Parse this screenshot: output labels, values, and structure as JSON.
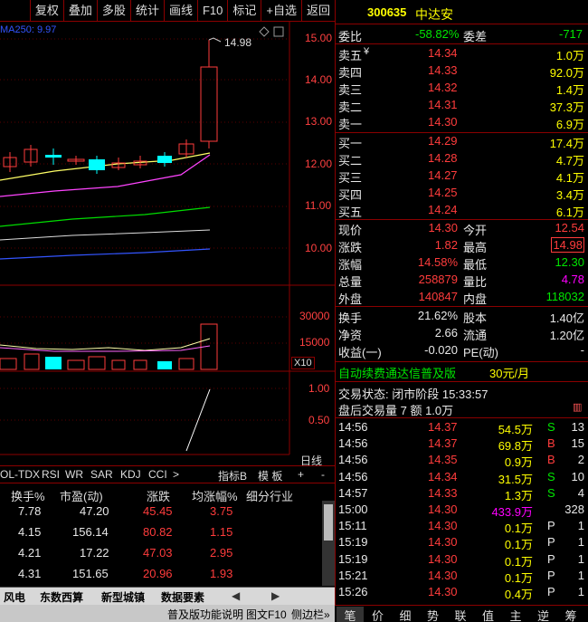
{
  "toolbar": {
    "items": [
      "复权",
      "叠加",
      "多股",
      "统计",
      "画线",
      "F10",
      "标记",
      "+自选",
      "返回"
    ]
  },
  "chart": {
    "ma_label": "MA250: 9.97",
    "high_marker": "14.98",
    "price_axis": [
      "15.00",
      "14.00",
      "13.00",
      "12.00",
      "11.00",
      "10.00"
    ],
    "vol_axis": [
      "30000",
      "15000"
    ],
    "vol_unit": "X10",
    "ind_axis": [
      "1.00",
      "0.50"
    ],
    "ind_label": "日线"
  },
  "quote": {
    "code": "300635",
    "name": "中达安",
    "weibi_label": "委比",
    "weibi": "-58.82%",
    "weicha_label": "委差",
    "weicha": "-717",
    "asks": [
      {
        "label": "卖五",
        "price": "14.34",
        "vol": "1.0万",
        "mark": "¥"
      },
      {
        "label": "卖四",
        "price": "14.33",
        "vol": "92.0万",
        "mark": ""
      },
      {
        "label": "卖三",
        "price": "14.32",
        "vol": "1.4万",
        "mark": ""
      },
      {
        "label": "卖二",
        "price": "14.31",
        "vol": "37.3万",
        "mark": ""
      },
      {
        "label": "卖一",
        "price": "14.30",
        "vol": "6.9万",
        "mark": ""
      }
    ],
    "bids": [
      {
        "label": "买一",
        "price": "14.29",
        "vol": "17.4万"
      },
      {
        "label": "买二",
        "price": "14.28",
        "vol": "4.7万"
      },
      {
        "label": "买三",
        "price": "14.27",
        "vol": "4.1万"
      },
      {
        "label": "买四",
        "price": "14.25",
        "vol": "3.4万"
      },
      {
        "label": "买五",
        "price": "14.24",
        "vol": "6.1万"
      }
    ],
    "stats": [
      {
        "l1": "现价",
        "v1": "14.30",
        "l2": "今开",
        "v2": "12.54"
      },
      {
        "l1": "涨跌",
        "v1": "1.82",
        "l2": "最高",
        "v2": "14.98"
      },
      {
        "l1": "涨幅",
        "v1": "14.58%",
        "l2": "最低",
        "v2": "12.30"
      },
      {
        "l1": "总量",
        "v1": "258879",
        "l2": "量比",
        "v2": "4.78"
      },
      {
        "l1": "外盘",
        "v1": "140847",
        "l2": "内盘",
        "v2": "118032"
      }
    ],
    "stats2": [
      {
        "l1": "换手",
        "v1": "21.62%",
        "l2": "股本",
        "v2": "1.40亿"
      },
      {
        "l1": "净资",
        "v1": "2.66",
        "l2": "流通",
        "v2": "1.20亿"
      },
      {
        "l1": "收益(一)",
        "v1": "-0.020",
        "l2": "PE(动)",
        "v2": "-"
      }
    ],
    "promo": "自动续费通达信普及版",
    "promo_price": "30元/月",
    "trade_status": "交易状态: 闭市阶段 15:33:57",
    "after_hours": "盘后交易量 7 额 1.0万"
  },
  "ticks": [
    {
      "t": "14:56",
      "p": "14.37",
      "v": "54.5万",
      "d": "S",
      "n": "13"
    },
    {
      "t": "14:56",
      "p": "14.37",
      "v": "69.8万",
      "d": "B",
      "n": "15"
    },
    {
      "t": "14:56",
      "p": "14.35",
      "v": "0.9万",
      "d": "B",
      "n": "2"
    },
    {
      "t": "14:56",
      "p": "14.34",
      "v": "31.5万",
      "d": "S",
      "n": "10"
    },
    {
      "t": "14:57",
      "p": "14.33",
      "v": "1.3万",
      "d": "S",
      "n": "4"
    },
    {
      "t": "15:00",
      "p": "14.30",
      "v": "433.9万",
      "d": "",
      "n": "328"
    },
    {
      "t": "15:11",
      "p": "14.30",
      "v": "0.1万",
      "d": "P",
      "n": "1"
    },
    {
      "t": "15:19",
      "p": "14.30",
      "v": "0.1万",
      "d": "P",
      "n": "1"
    },
    {
      "t": "15:19",
      "p": "14.30",
      "v": "0.1万",
      "d": "P",
      "n": "1"
    },
    {
      "t": "15:21",
      "p": "14.30",
      "v": "0.1万",
      "d": "P",
      "n": "1"
    },
    {
      "t": "15:26",
      "p": "14.30",
      "v": "0.4万",
      "d": "P",
      "n": "1"
    }
  ],
  "ind_tabs": [
    "OL-TDX",
    "RSI",
    "WR",
    "SAR",
    "KDJ",
    "CCI",
    ">",
    "指标B",
    "模 板",
    "+",
    "-"
  ],
  "table": {
    "headers": [
      "换手%",
      "市盈(动)",
      "涨跌",
      "均涨幅%",
      "细分行业"
    ],
    "rows": [
      [
        "7.78",
        "47.20",
        "45.45",
        "3.75"
      ],
      [
        "4.15",
        "156.14",
        "80.82",
        "1.15"
      ],
      [
        "4.21",
        "17.22",
        "47.03",
        "2.95"
      ],
      [
        "4.31",
        "151.65",
        "20.96",
        "1.93"
      ]
    ]
  },
  "sector_tabs": [
    "风电",
    "东数西算",
    "新型城镇",
    "数据要素"
  ],
  "statusbar": [
    "普及版功能说明",
    "图文F10",
    "侧边栏»"
  ],
  "right_tabs": [
    "笔",
    "价",
    "细",
    "势",
    "联",
    "值",
    "主",
    "逆",
    "筹"
  ]
}
